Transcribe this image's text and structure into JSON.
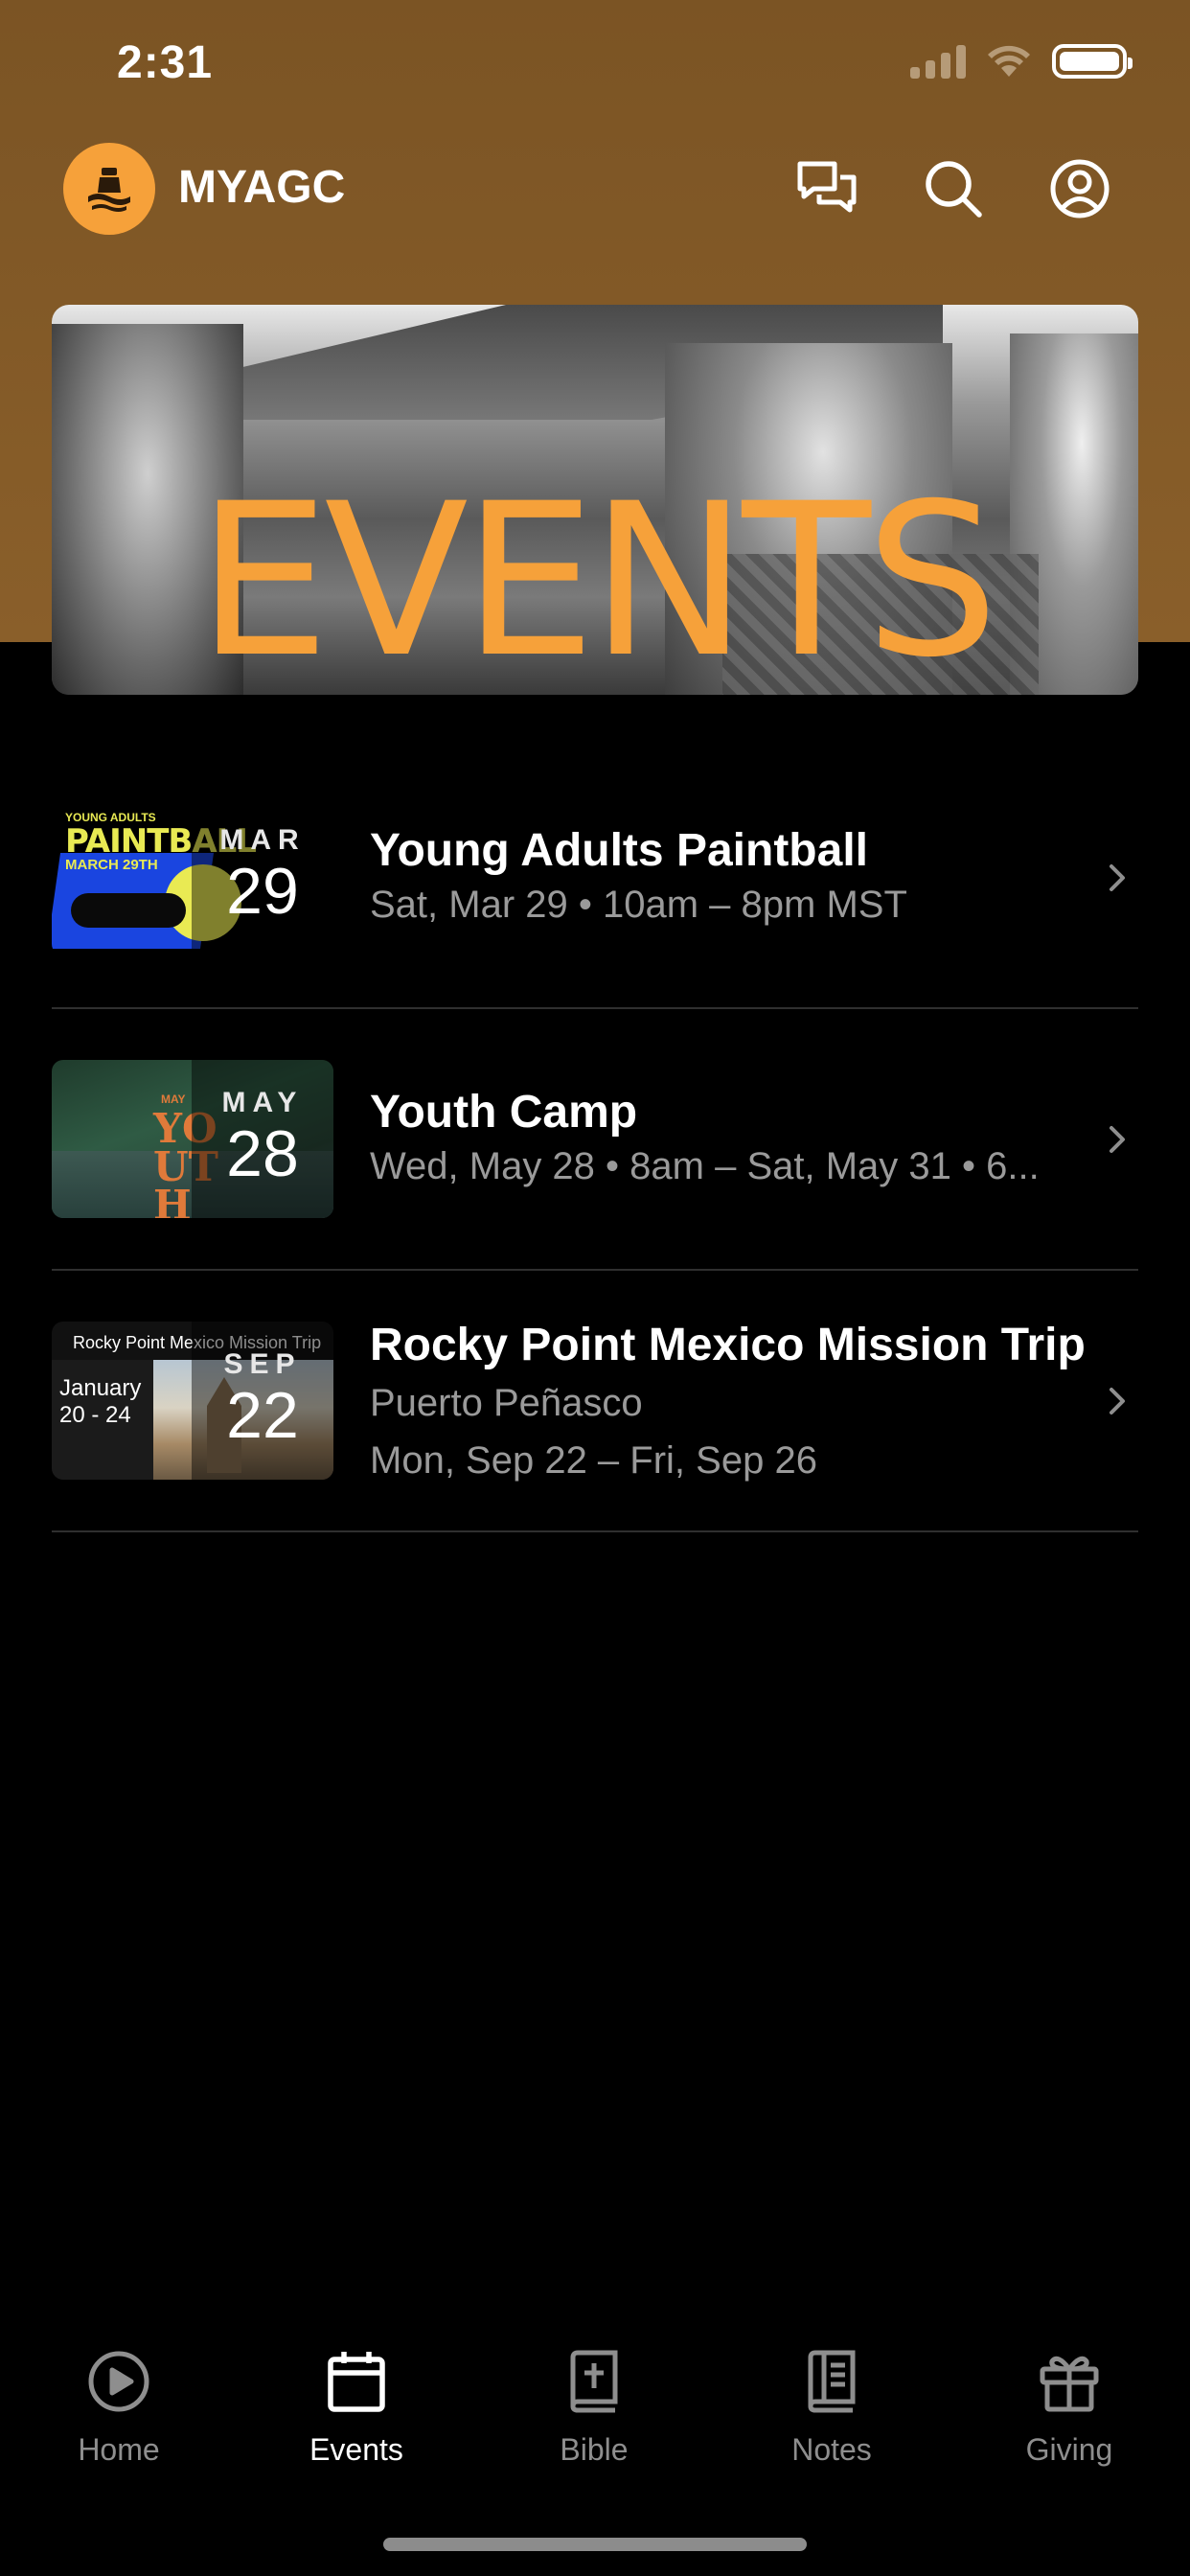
{
  "status_bar": {
    "time": "2:31",
    "icons": [
      "signal-icon",
      "wifi-icon",
      "battery-icon"
    ]
  },
  "header": {
    "app_title": "MYAGC",
    "icons": [
      "chat-icon",
      "search-icon",
      "profile-icon"
    ],
    "accent_color": "#f6a13a",
    "background_color": "#7b5424"
  },
  "banner": {
    "title": "EVENTS"
  },
  "events": [
    {
      "title": "Young Adults Paintball",
      "line1": "Sat, Mar 29 • 10am – 8pm MST",
      "line2": "",
      "month": "MAR",
      "day": "29",
      "thumb": {
        "label1": "YOUNG ADULTS",
        "label2": "PAINTBALL",
        "label3": "MARCH 29TH"
      }
    },
    {
      "title": "Youth Camp",
      "line1": "Wed, May 28 • 8am – Sat, May 31 • 6...",
      "line2": "",
      "month": "MAY",
      "day": "28",
      "thumb": {
        "label1": "MAY",
        "label2": "YOUTH CAMP"
      }
    },
    {
      "title": "Rocky Point Mexico Mission Trip",
      "line1": "Puerto Peñasco",
      "line2": "Mon, Sep 22 – Fri, Sep 26",
      "month": "SEP",
      "day": "22",
      "thumb": {
        "label1": "Rocky Point Mexico Mission Trip",
        "label2": "January",
        "label3": "20 - 24"
      }
    }
  ],
  "tab_bar": {
    "tabs": [
      {
        "label": "Home",
        "icon": "play-circle-icon",
        "active": false
      },
      {
        "label": "Events",
        "icon": "calendar-icon",
        "active": true
      },
      {
        "label": "Bible",
        "icon": "bible-icon",
        "active": false
      },
      {
        "label": "Notes",
        "icon": "notes-icon",
        "active": false
      },
      {
        "label": "Giving",
        "icon": "gift-icon",
        "active": false
      }
    ]
  }
}
